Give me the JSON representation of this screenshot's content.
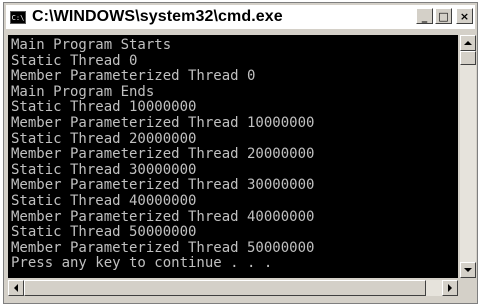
{
  "window": {
    "title": "C:\\WINDOWS\\system32\\cmd.exe",
    "icon_text": "C:\\",
    "buttons": {
      "minimize": "_",
      "maximize": "□",
      "close": "×"
    }
  },
  "console": {
    "lines": [
      "Main Program Starts",
      "Static Thread 0",
      "Member Parameterized Thread 0",
      "Main Program Ends",
      "Static Thread 10000000",
      "Member Parameterized Thread 10000000",
      "Static Thread 20000000",
      "Member Parameterized Thread 20000000",
      "Static Thread 30000000",
      "Member Parameterized Thread 30000000",
      "Static Thread 40000000",
      "Member Parameterized Thread 40000000",
      "Static Thread 50000000",
      "Member Parameterized Thread 50000000",
      "Press any key to continue . . ."
    ]
  },
  "colors": {
    "console_bg": "#000000",
    "console_fg": "#c0c0c0",
    "chrome": "#d4d0c8"
  },
  "icons": {
    "app": "cmd-icon",
    "scroll_up": "up-arrow-icon",
    "scroll_down": "down-arrow-icon",
    "scroll_left": "left-arrow-icon",
    "scroll_right": "right-arrow-icon"
  }
}
